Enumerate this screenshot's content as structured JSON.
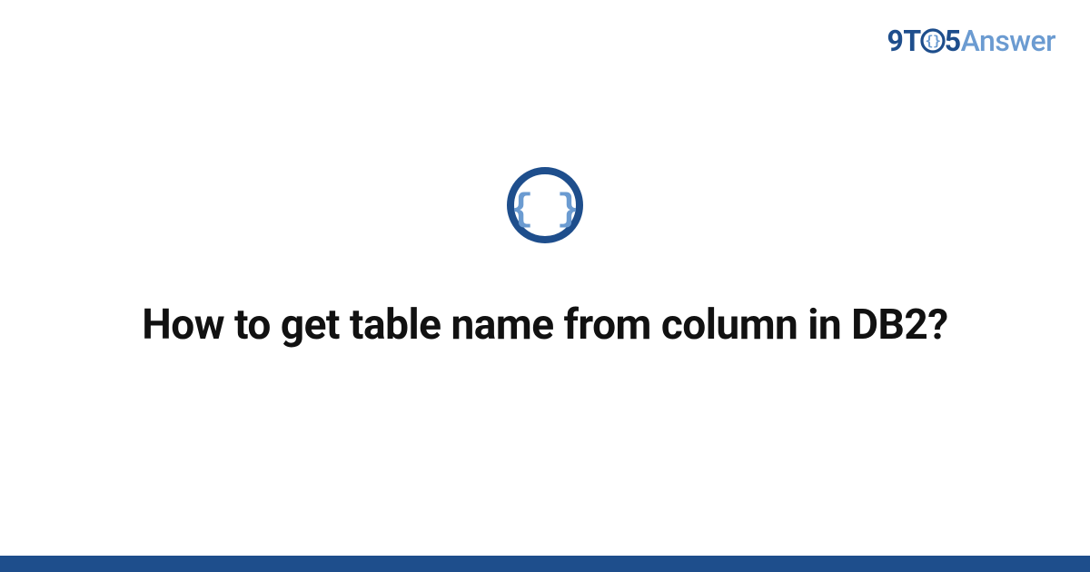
{
  "logo": {
    "part_nine_t": "9T",
    "part_five": "5",
    "part_answer": "Answer"
  },
  "icon": {
    "name": "curly-braces-icon"
  },
  "question": {
    "title": "How to get table name from column in DB2?"
  },
  "colors": {
    "brand_dark": "#1e4e8c",
    "brand_light": "#6b9bd1"
  }
}
